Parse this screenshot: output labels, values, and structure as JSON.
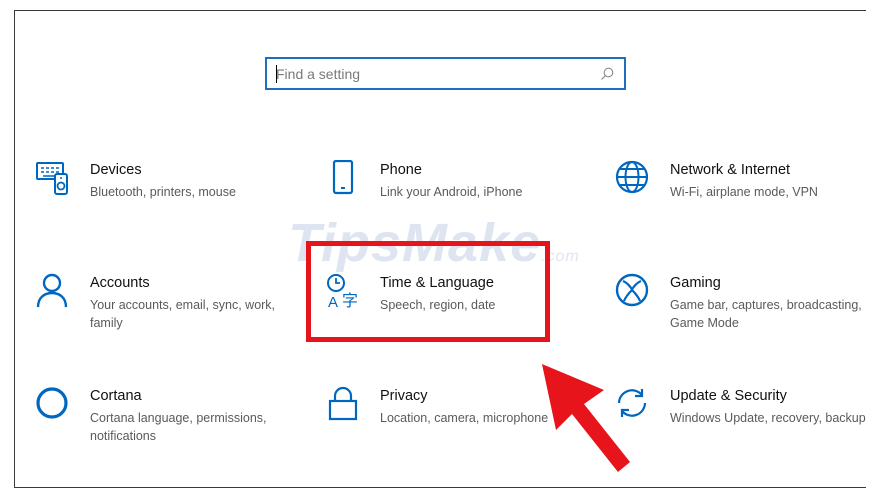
{
  "search": {
    "placeholder": "Find a setting"
  },
  "tiles": [
    {
      "title": "Devices",
      "desc": "Bluetooth, printers, mouse",
      "icon": "devices-icon"
    },
    {
      "title": "Phone",
      "desc": "Link your Android, iPhone",
      "icon": "phone-icon"
    },
    {
      "title": "Network & Internet",
      "desc": "Wi-Fi, airplane mode, VPN",
      "icon": "globe-icon"
    },
    {
      "title": "Accounts",
      "desc": "Your accounts, email, sync, work, family",
      "icon": "person-icon"
    },
    {
      "title": "Time & Language",
      "desc": "Speech, region, date",
      "icon": "time-language-icon"
    },
    {
      "title": "Gaming",
      "desc": "Game bar, captures, broadcasting, Game Mode",
      "icon": "xbox-icon"
    },
    {
      "title": "Cortana",
      "desc": "Cortana language, permissions, notifications",
      "icon": "cortana-icon"
    },
    {
      "title": "Privacy",
      "desc": "Location, camera, microphone",
      "icon": "lock-icon"
    },
    {
      "title": "Update & Security",
      "desc": "Windows Update, recovery, backup",
      "icon": "sync-icon"
    }
  ],
  "watermark": {
    "main": "TipsMake",
    "suffix": ".com"
  },
  "colors": {
    "accent": "#0067c0",
    "highlight": "#e8141c",
    "search_border": "#1f6fbf"
  }
}
